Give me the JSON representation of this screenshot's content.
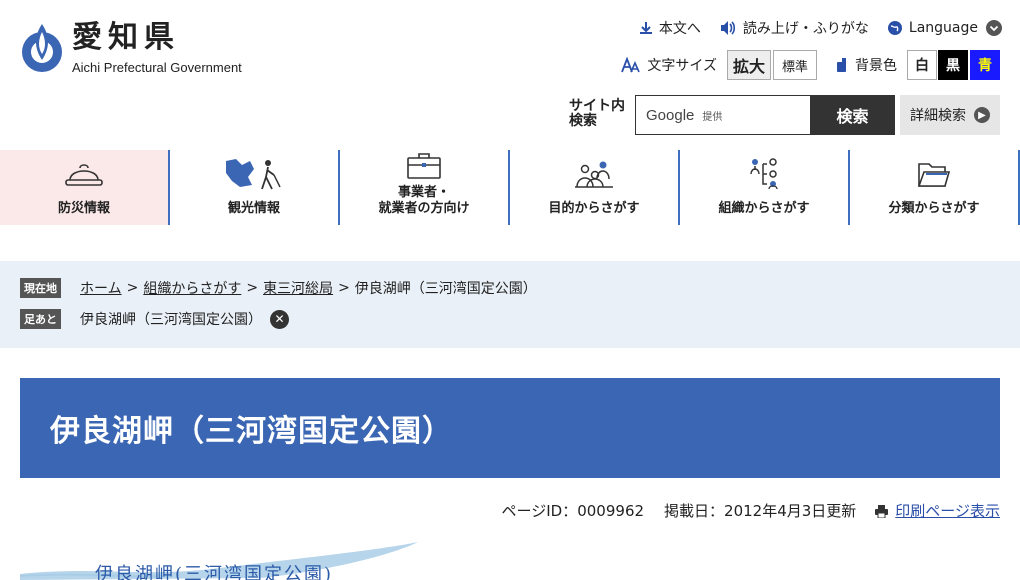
{
  "header": {
    "logo_ja": "愛知県",
    "logo_en": "Aichi Prefectural Government",
    "links": {
      "to_content": "本文へ",
      "read_aloud": "読み上げ・ふりがな",
      "language": "Language"
    },
    "text_size": {
      "label": "文字サイズ",
      "large": "拡大",
      "standard": "標準"
    },
    "bg_color": {
      "label": "背景色",
      "white": "白",
      "black": "黒",
      "blue": "青"
    },
    "search": {
      "label_line1": "サイト内",
      "label_line2": "検索",
      "google": "Google",
      "provided": "提供",
      "button": "検索",
      "advanced": "詳細検索"
    }
  },
  "gnav": [
    {
      "label": "防災情報",
      "icon": "helmet-icon"
    },
    {
      "label": "観光情報",
      "icon": "tourism-icon"
    },
    {
      "label_line1": "事業者・",
      "label_line2": "就業者の方向け",
      "icon": "briefcase-icon"
    },
    {
      "label": "目的からさがす",
      "icon": "people-icon"
    },
    {
      "label": "組織からさがす",
      "icon": "org-chart-icon"
    },
    {
      "label": "分類からさがす",
      "icon": "folder-icon"
    }
  ],
  "breadcrumb": {
    "current_tag": "現在地",
    "items": [
      "ホーム",
      "組織からさがす",
      "東三河総局"
    ],
    "current": "伊良湖岬（三河湾国定公園）",
    "sep": ">",
    "history_tag": "足あと",
    "history_item": "伊良湖岬（三河湾国定公園）"
  },
  "page": {
    "title": "伊良湖岬（三河湾国定公園）",
    "page_id": "ページID：0009962",
    "published": "掲載日：2012年4月3日更新",
    "print": "印刷ページ表示",
    "banner_text": "伊良湖岬(三河湾国定公園)"
  },
  "colors": {
    "brand_blue": "#3a66b3",
    "nav_divider": "#3f6fbf",
    "crumb_bg": "#eaf0f7",
    "active_nav_bg": "#fbe9e9"
  }
}
